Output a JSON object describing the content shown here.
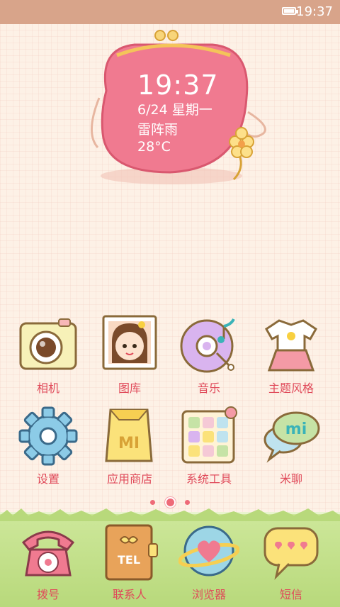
{
  "status_bar": {
    "time": "19:37"
  },
  "clock_widget": {
    "time": "19:37",
    "date": "6/24  星期一",
    "weather": "雷阵雨",
    "temperature": "28°C"
  },
  "apps": [
    {
      "label": "相机",
      "icon": "camera-icon"
    },
    {
      "label": "图库",
      "icon": "gallery-icon"
    },
    {
      "label": "音乐",
      "icon": "music-icon"
    },
    {
      "label": "主题风格",
      "icon": "theme-icon"
    },
    {
      "label": "设置",
      "icon": "settings-gear-icon"
    },
    {
      "label": "应用商店",
      "icon": "app-store-bag-icon"
    },
    {
      "label": "系统工具",
      "icon": "system-tools-icon"
    },
    {
      "label": "米聊",
      "icon": "miliao-chat-icon"
    }
  ],
  "page_indicator": {
    "pages": 3,
    "current": 2
  },
  "dock": [
    {
      "label": "拨号",
      "icon": "phone-icon"
    },
    {
      "label": "联系人",
      "icon": "contacts-icon"
    },
    {
      "label": "浏览器",
      "icon": "browser-icon"
    },
    {
      "label": "短信",
      "icon": "messages-icon"
    }
  ],
  "icon_texts": {
    "store": "MI",
    "chat": "mi",
    "contacts": "TEL"
  },
  "colors": {
    "status_bar": "#d8a48a",
    "label": "#e04a5a",
    "purse": "#f07a90",
    "dock": "#c3df8d"
  }
}
